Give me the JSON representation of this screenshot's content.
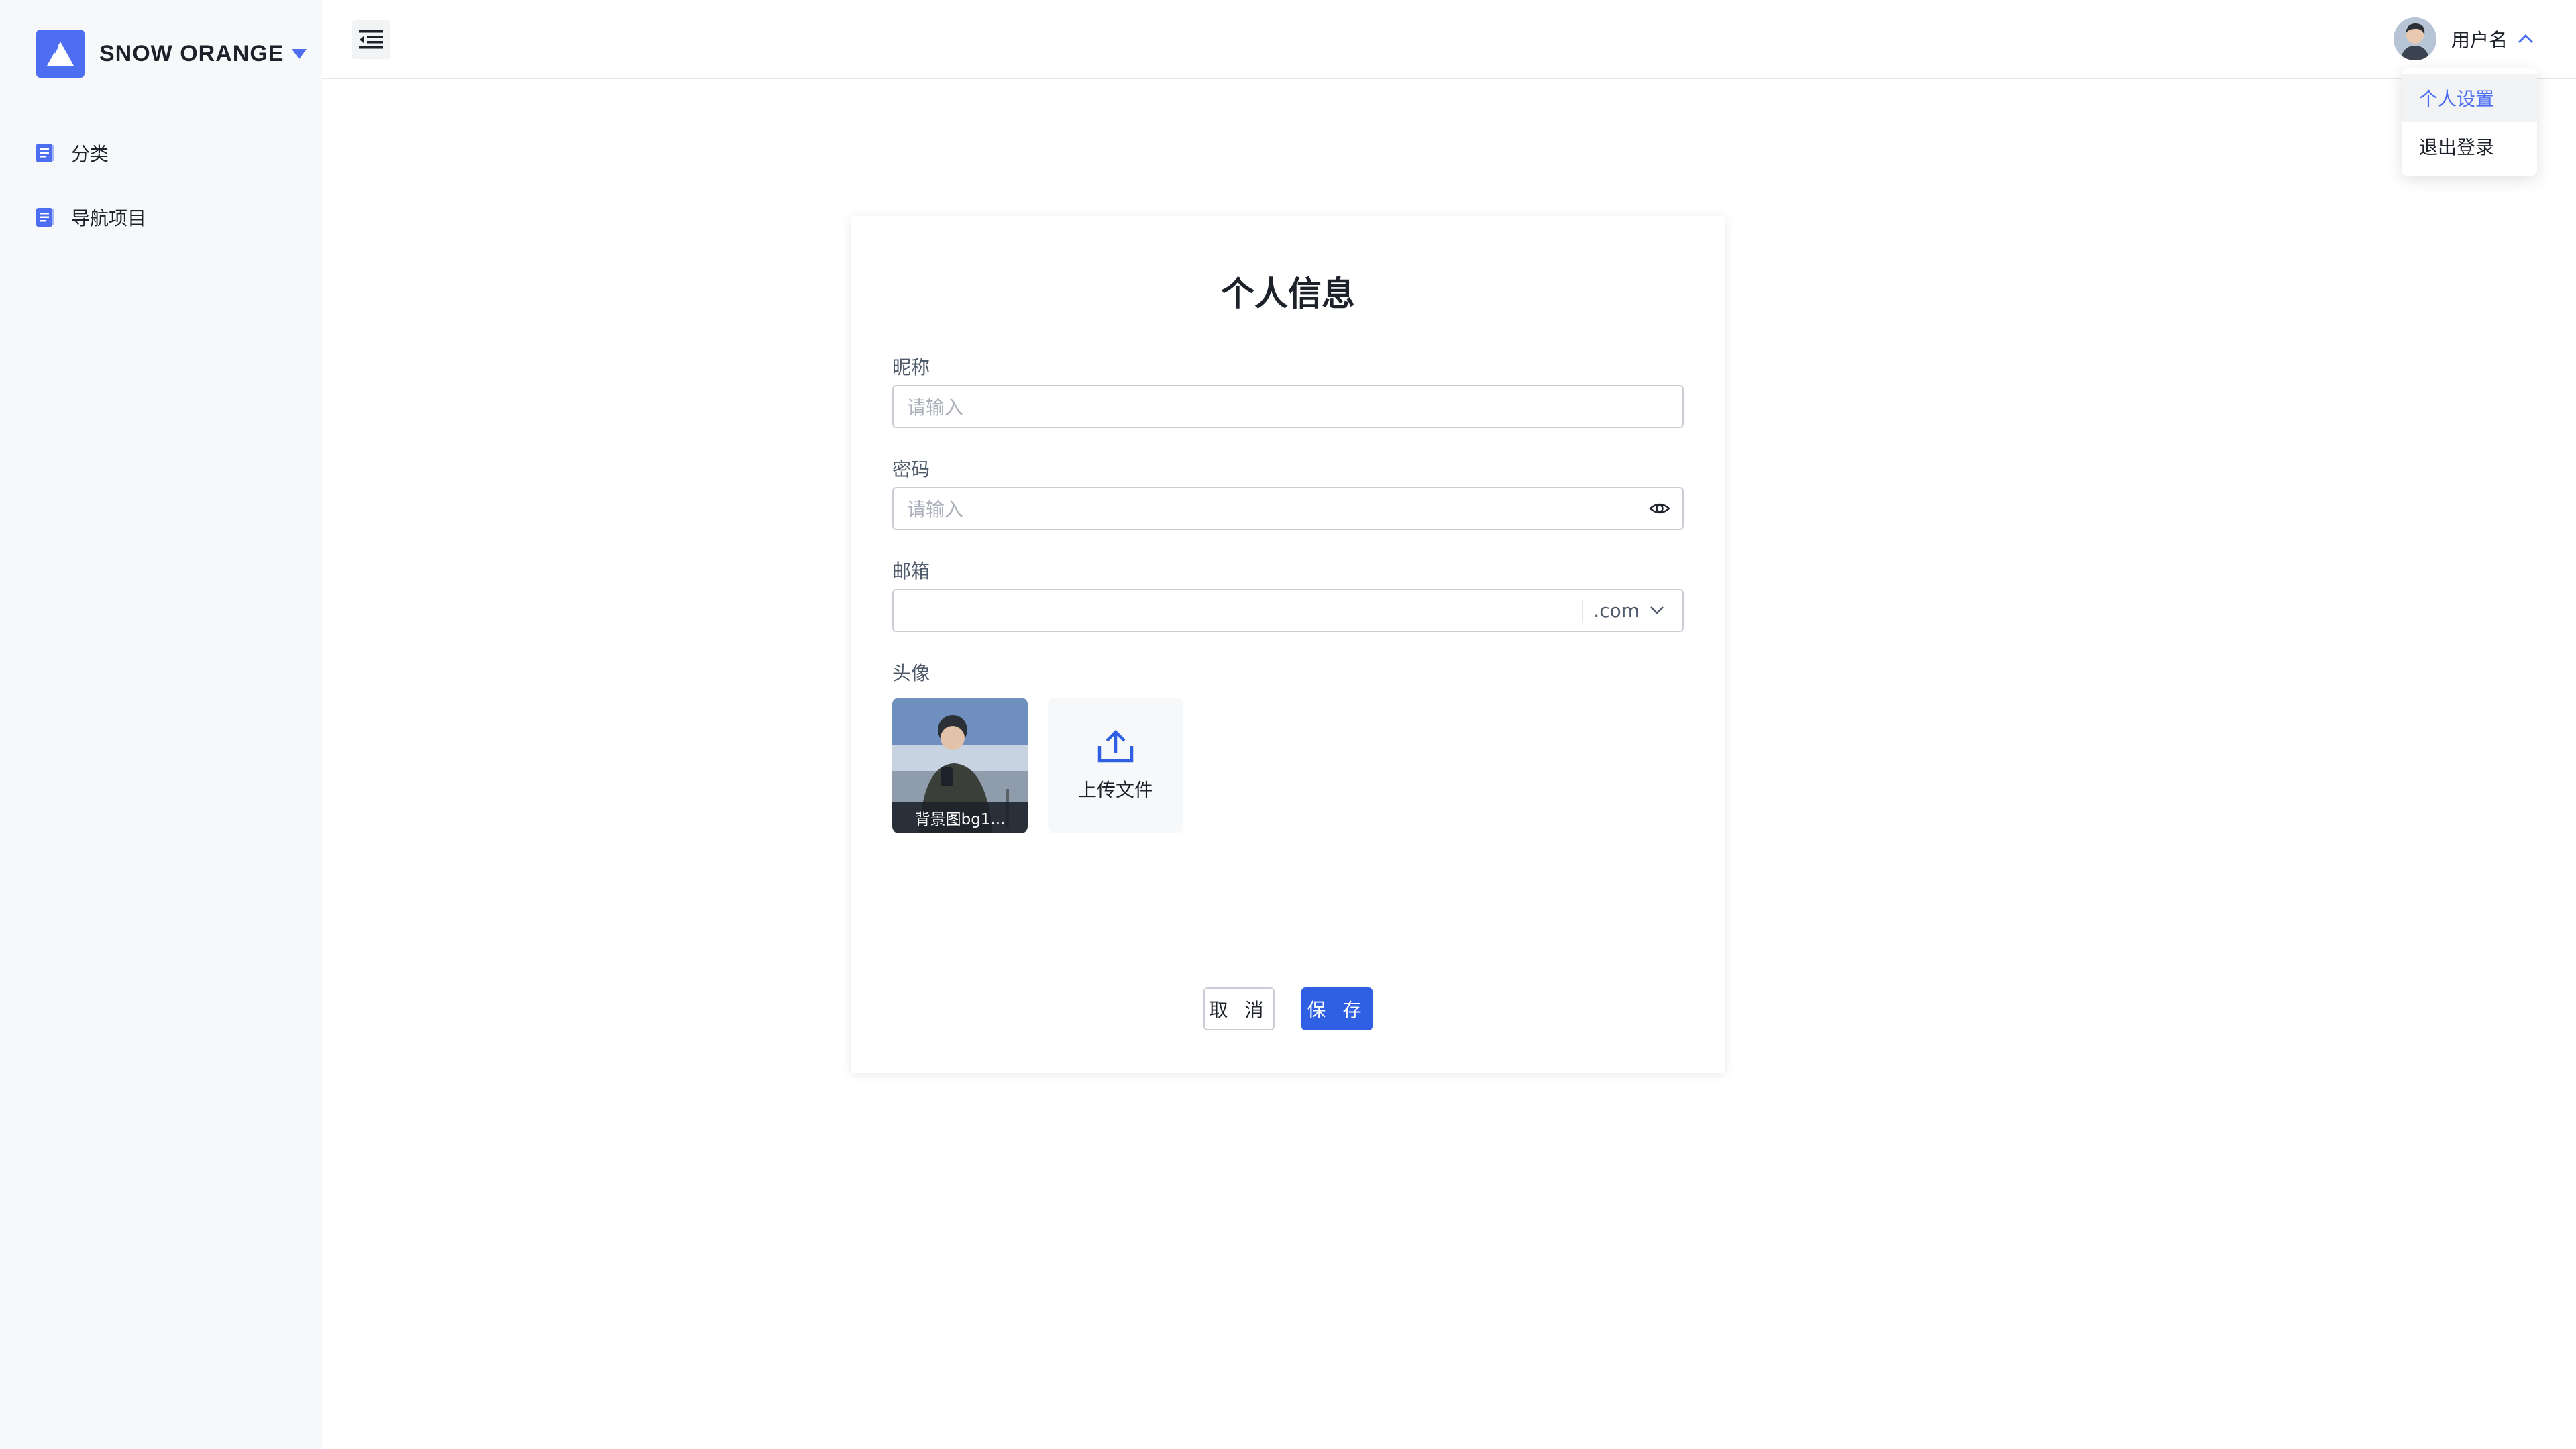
{
  "brand": {
    "name": "SNOW ORANGE"
  },
  "sidebar": {
    "items": [
      {
        "label": "分类",
        "icon": "document-icon"
      },
      {
        "label": "导航项目",
        "icon": "document-icon"
      }
    ]
  },
  "header": {
    "menu_icon": "menu-fold-icon",
    "user_name": "用户名"
  },
  "user_menu": {
    "items": [
      {
        "label": "个人设置",
        "active": true
      },
      {
        "label": "退出登录",
        "active": false
      }
    ]
  },
  "form": {
    "title": "个人信息",
    "nickname": {
      "label": "昵称",
      "placeholder": "请输入",
      "value": ""
    },
    "password": {
      "label": "密码",
      "placeholder": "请输入",
      "value": ""
    },
    "email": {
      "label": "邮箱",
      "value": "",
      "suffix": ".com"
    },
    "avatar": {
      "label": "头像",
      "uploaded_name": "背景图bg1...",
      "upload_label": "上传文件"
    },
    "cancel_label": "取 消",
    "save_label": "保 存"
  },
  "colors": {
    "primary": "#2f5fe3",
    "brand": "#4e6ef2",
    "sidebar_bg": "#f7f8fa"
  }
}
